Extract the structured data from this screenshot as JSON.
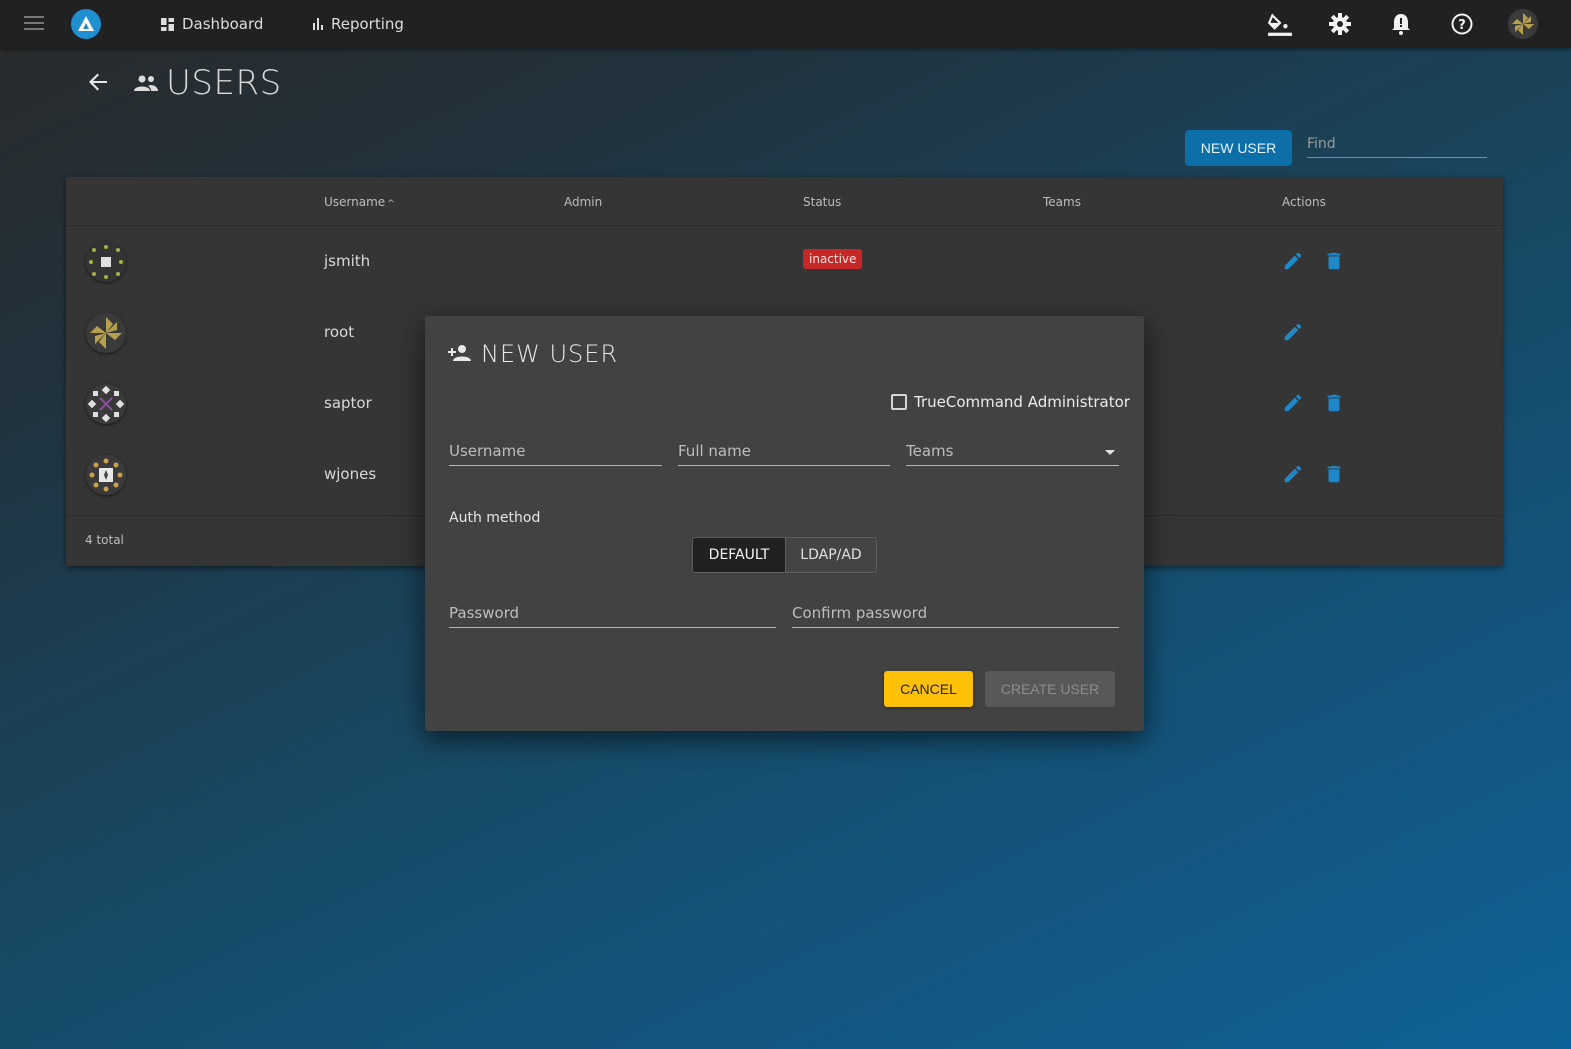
{
  "topbar": {
    "nav": [
      {
        "label": "Dashboard",
        "icon": "dashboard-icon"
      },
      {
        "label": "Reporting",
        "icon": "bar-chart-icon"
      }
    ],
    "icons": [
      "paint-bucket-icon",
      "gear-icon",
      "bell-icon",
      "help-icon",
      "user-avatar"
    ]
  },
  "page": {
    "title": "USERS",
    "new_user_label": "NEW USER",
    "find_placeholder": "Find"
  },
  "table": {
    "columns": {
      "username": "Username",
      "admin": "Admin",
      "status": "Status",
      "teams": "Teams",
      "actions": "Actions"
    },
    "sort_indicator": "^",
    "rows": [
      {
        "username": "jsmith",
        "status": "inactive",
        "deletable": true
      },
      {
        "username": "root",
        "status": "",
        "deletable": false
      },
      {
        "username": "saptor",
        "status": "",
        "deletable": true
      },
      {
        "username": "wjones",
        "status": "",
        "deletable": true
      }
    ],
    "total_label": "4 total"
  },
  "dialog": {
    "title": "NEW USER",
    "admin_checkbox_label": "TrueCommand Administrator",
    "admin_checked": false,
    "username_placeholder": "Username",
    "fullname_placeholder": "Full name",
    "teams_placeholder": "Teams",
    "auth_method_label": "Auth method",
    "auth_options": [
      "DEFAULT",
      "LDAP/AD"
    ],
    "auth_selected": "DEFAULT",
    "password_placeholder": "Password",
    "confirm_password_placeholder": "Confirm password",
    "cancel_label": "CANCEL",
    "create_label": "CREATE USER"
  },
  "colors": {
    "accent_blue": "#1f88c8",
    "badge_red": "#c62828",
    "cancel_yellow": "#ffc107"
  }
}
